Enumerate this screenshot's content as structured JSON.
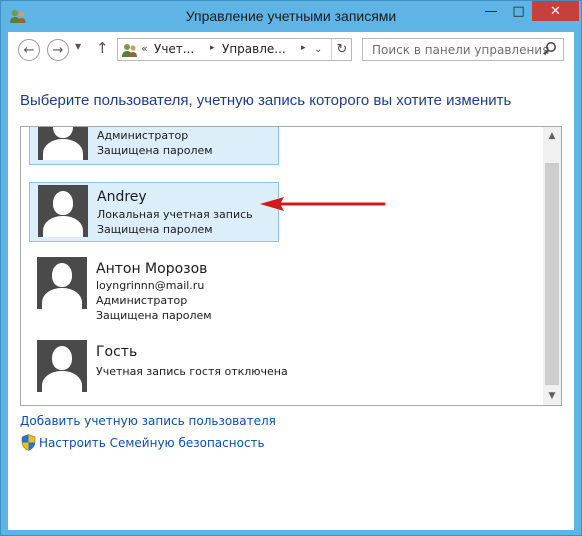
{
  "window": {
    "title": "Управление учетными записями",
    "buttons": {
      "minimize": "—",
      "maximize": "□",
      "close": "✕"
    }
  },
  "toolbar": {
    "back_icon": "←",
    "forward_icon": "→",
    "recent_icon": "▼",
    "up_icon": "↑",
    "address": {
      "chevron": "«",
      "crumb1": "Учет...",
      "separator": "▸",
      "crumb2": "Управле...",
      "dropdown_icon": "⌄",
      "refresh_icon": "↻"
    },
    "search": {
      "placeholder": "Поиск в панели управления",
      "icon": "⚲"
    }
  },
  "heading": "Выберите пользователя, учетную запись которого вы хотите изменить",
  "accounts": [
    {
      "name": "",
      "lines": [
        "Администратор",
        "Защищена паролем"
      ],
      "selected": true
    },
    {
      "name": "Andrey",
      "lines": [
        "Локальная учетная запись",
        "Защищена паролем"
      ],
      "selected": true
    },
    {
      "name": "Антон Морозов",
      "lines": [
        "loyngrinnn@mail.ru",
        "Администратор",
        "Защищена паролем"
      ],
      "selected": false
    },
    {
      "name": "Гость",
      "lines": [
        "Учетная запись гостя отключена"
      ],
      "selected": false
    }
  ],
  "scroll": {
    "up": "▲",
    "down": "▼"
  },
  "links": {
    "add_account": "Добавить учетную запись пользователя",
    "family_safety": "Настроить Семейную безопасность"
  },
  "colors": {
    "titlebar": "#5fb4e6",
    "heading": "#1e3d8f",
    "link": "#0a4fae",
    "selected_bg": "#ddeefb",
    "arrow": "#d11a1a"
  }
}
